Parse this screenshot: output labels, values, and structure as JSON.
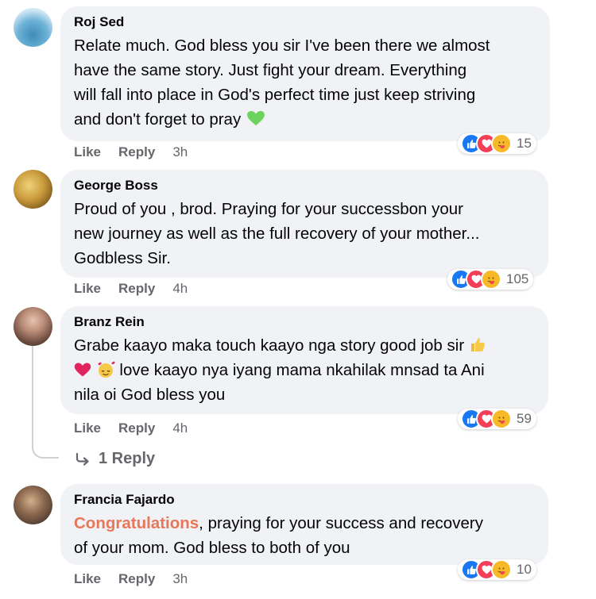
{
  "comments": [
    {
      "name": "Roj Sed",
      "text_lines": [
        "Relate much. God bless you sir I've been there we almost",
        "have the same story. Just fight your dream. Everything",
        "will fall into place in God's perfect time just keep striving",
        "and don't forget to pray"
      ],
      "like_label": "Like",
      "reply_label": "Reply",
      "time": "3h",
      "reaction_count": "15"
    },
    {
      "name": "George Boss",
      "text_lines": [
        "Proud of you , brod. Praying for your successbon your",
        "new journey as well as the full recovery of your mother...",
        "Godbless Sir."
      ],
      "like_label": "Like",
      "reply_label": "Reply",
      "time": "4h",
      "reaction_count": "105"
    },
    {
      "name": "Branz Rein",
      "text_lines": [
        "Grabe kaayo maka touch kaayo nga story good job sir",
        "love kaayo nya iyang mama nkahilak mnsad ta Ani",
        "nila oi God bless you"
      ],
      "like_label": "Like",
      "reply_label": "Reply",
      "time": "4h",
      "reaction_count": "59",
      "replies_label": "1 Reply"
    },
    {
      "name": "Francia Fajardo",
      "highlight": "Congratulations",
      "text_lines": [
        ", praying for your success and recovery",
        "of your mom. God bless to both of you"
      ],
      "like_label": "Like",
      "reply_label": "Reply",
      "time": "3h",
      "reaction_count": "10"
    }
  ],
  "icons": {
    "reactions": [
      "like-icon",
      "love-icon",
      "care-icon"
    ],
    "reply_arrow": "reply-arrow-icon"
  },
  "colors": {
    "bubble": "#f0f2f5",
    "meta_text": "#65676b",
    "like": "#1877f2",
    "love": "#f33e58",
    "care": "#f7b928",
    "highlight": "#e8775a"
  }
}
